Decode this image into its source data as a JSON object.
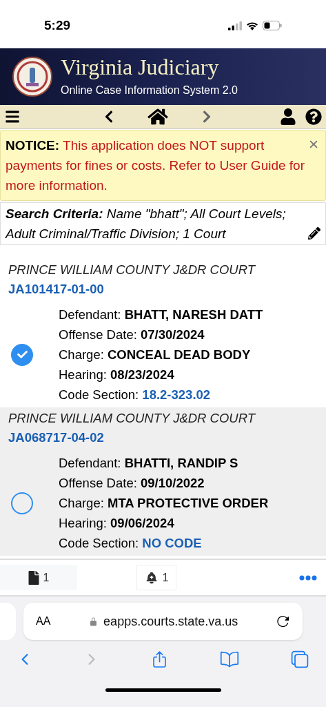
{
  "status_bar": {
    "time": "5:29"
  },
  "header": {
    "title": "Virginia Judiciary",
    "subtitle": "Online Case Information System 2.0"
  },
  "notice": {
    "label": "NOTICE:",
    "text": "This application does NOT support payments for fines or costs. Refer to User Guide for more information."
  },
  "search_criteria": {
    "label": "Search Criteria:",
    "text": "Name \"bhatt\"; All Court Levels; Adult Criminal/Traffic Division; 1 Court"
  },
  "cases": [
    {
      "court": "PRINCE WILLIAM COUNTY J&DR COURT",
      "case_number": "JA101417-01-00",
      "selected": true,
      "fields": [
        {
          "label": "Defendant:",
          "value": "BHATT, NARESH DATT",
          "kind": "text"
        },
        {
          "label": "Offense Date:",
          "value": "07/30/2024",
          "kind": "text"
        },
        {
          "label": "Charge:",
          "value": "CONCEAL DEAD BODY",
          "kind": "text"
        },
        {
          "label": "Hearing:",
          "value": "08/23/2024",
          "kind": "text"
        },
        {
          "label": "Code Section:",
          "value": "18.2-323.02",
          "kind": "link"
        }
      ]
    },
    {
      "court": "PRINCE WILLIAM COUNTY J&DR COURT",
      "case_number": "JA068717-04-02",
      "selected": false,
      "fields": [
        {
          "label": "Defendant:",
          "value": "BHATTI, RANDIP S",
          "kind": "text"
        },
        {
          "label": "Offense Date:",
          "value": "09/10/2022",
          "kind": "text"
        },
        {
          "label": "Charge:",
          "value": "MTA PROTECTIVE ORDER",
          "kind": "text"
        },
        {
          "label": "Hearing:",
          "value": "09/06/2024",
          "kind": "text"
        },
        {
          "label": "Code Section:",
          "value": "NO CODE",
          "kind": "link"
        }
      ]
    }
  ],
  "bottom_tabs": [
    {
      "count": "1",
      "kind": "documents",
      "selected": true
    },
    {
      "count": "1",
      "kind": "alerts",
      "selected": false
    }
  ],
  "browser": {
    "text_size": "AA",
    "url": "eapps.courts.state.va.us"
  }
}
